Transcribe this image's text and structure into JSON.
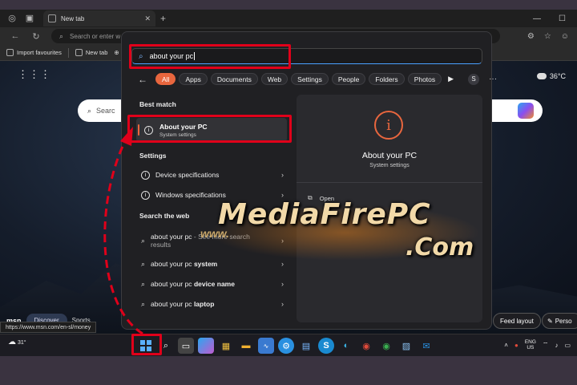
{
  "browser": {
    "tab_title": "New tab",
    "address_placeholder": "Search or enter w",
    "favourites": [
      {
        "label": "Import favourites"
      },
      {
        "label": "New tab"
      }
    ],
    "status_url": "https://www.msn.com/en-sl/money"
  },
  "background_page": {
    "search_placeholder": "Searc",
    "weather_temp": "36°C",
    "msn_logo": "msn",
    "discover_label": "Discover",
    "sports_label": "Sports",
    "feed_layout_label": "Feed layout",
    "personalize_label": "Perso"
  },
  "start_search": {
    "query": "about your pc",
    "filters": [
      {
        "label": "All",
        "active": true
      },
      {
        "label": "Apps"
      },
      {
        "label": "Documents"
      },
      {
        "label": "Web"
      },
      {
        "label": "Settings"
      },
      {
        "label": "People"
      },
      {
        "label": "Folders"
      },
      {
        "label": "Photos"
      }
    ],
    "account_initial": "S",
    "best_match_heading": "Best match",
    "best_match": {
      "title": "About your PC",
      "subtitle": "System settings"
    },
    "settings_heading": "Settings",
    "settings_items": [
      {
        "label": "Device specifications"
      },
      {
        "label": "Windows specifications"
      }
    ],
    "web_heading": "Search the web",
    "web_items": [
      {
        "prefix": "about your pc",
        "suffix": " - See more search",
        "line2": "results"
      },
      {
        "prefix": "about your pc ",
        "bold": "system"
      },
      {
        "prefix": "about your pc ",
        "bold": "device name"
      },
      {
        "prefix": "about your pc ",
        "bold": "laptop"
      }
    ],
    "detail": {
      "title": "About your PC",
      "subtitle": "System settings",
      "open_label": "Open"
    }
  },
  "watermark": {
    "line1": "MediaFirePC",
    "line2": ".Com",
    "prefix": "www."
  },
  "taskbar": {
    "weather_temp": "31°",
    "lang_line1": "ENG",
    "lang_line2": "US"
  },
  "colors": {
    "accent": "#e8663e",
    "highlight": "#e0001a",
    "panel": "#202023"
  }
}
